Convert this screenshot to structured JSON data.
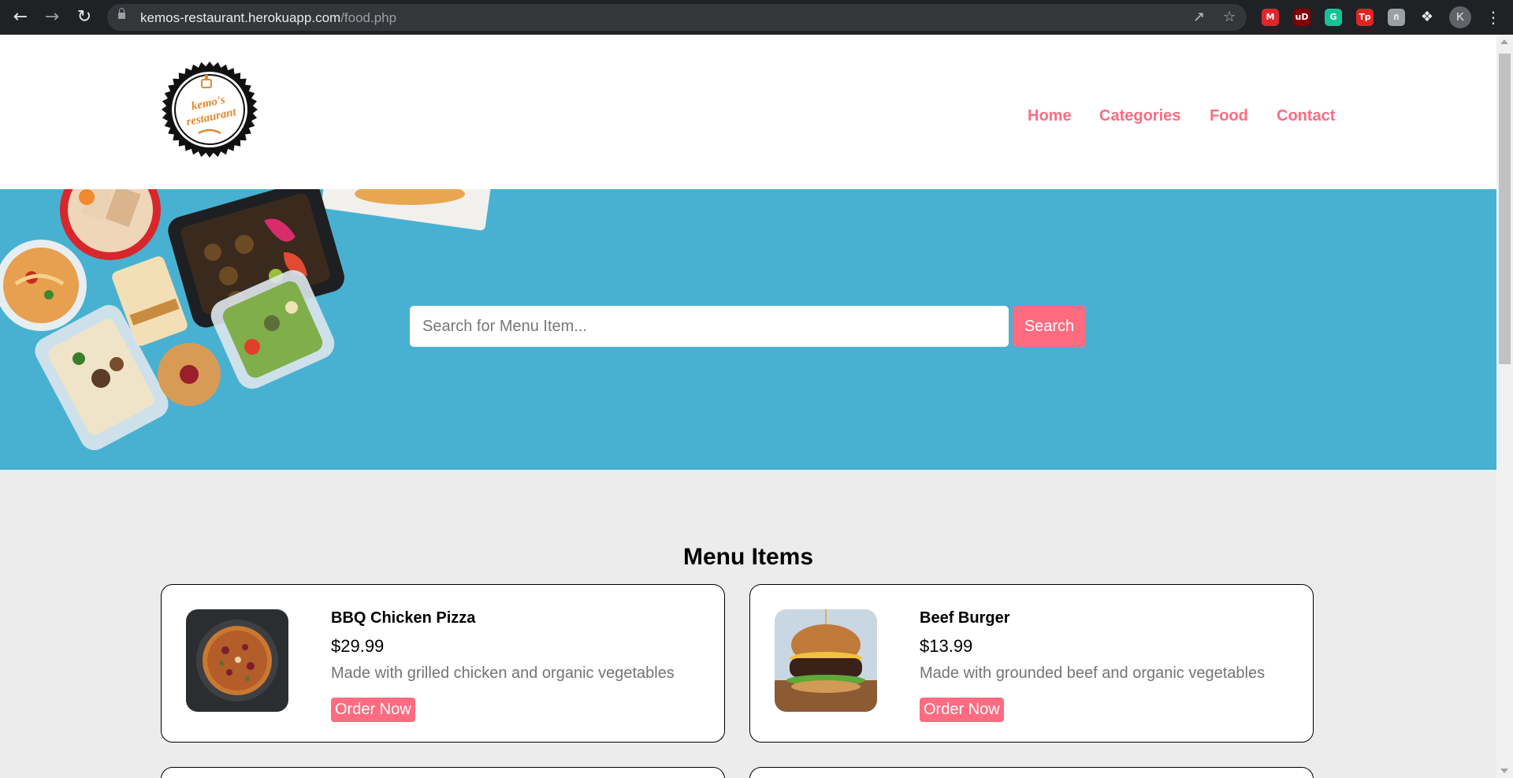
{
  "browser": {
    "url_host": "kemos-restaurant.herokuapp.com",
    "url_path": "/food.php",
    "profile_initial": "K",
    "extensions": [
      {
        "icon": "mega-icon",
        "label": "M",
        "color": "#e0262c"
      },
      {
        "icon": "ublock-icon",
        "label": "uD",
        "color": "#800000"
      },
      {
        "icon": "grammarly-icon",
        "label": "G",
        "color": "#15c39a"
      },
      {
        "icon": "tp-icon",
        "label": "Tp",
        "color": "#e02424"
      },
      {
        "icon": "ext-gray-icon",
        "label": "ก",
        "color": "#9aa0a6"
      }
    ]
  },
  "header": {
    "logo_text": [
      "kemo's",
      "restaurant"
    ],
    "nav": [
      "Home",
      "Categories",
      "Food",
      "Contact"
    ]
  },
  "search": {
    "placeholder": "Search for Menu Item...",
    "button_label": "Search"
  },
  "menu": {
    "title": "Menu Items",
    "items": [
      {
        "name": "BBQ Chicken Pizza",
        "price": "$29.99",
        "description": "Made with grilled chicken and organic vegetables",
        "button": "Order Now",
        "image": "pizza-image"
      },
      {
        "name": "Beef Burger",
        "price": "$13.99",
        "description": "Made with grounded beef and organic vegetables",
        "button": "Order Now",
        "image": "burger-image"
      }
    ]
  },
  "colors": {
    "accent": "#ff6b81",
    "hero_bg": "#48b1d1",
    "page_bg": "#ececec"
  }
}
